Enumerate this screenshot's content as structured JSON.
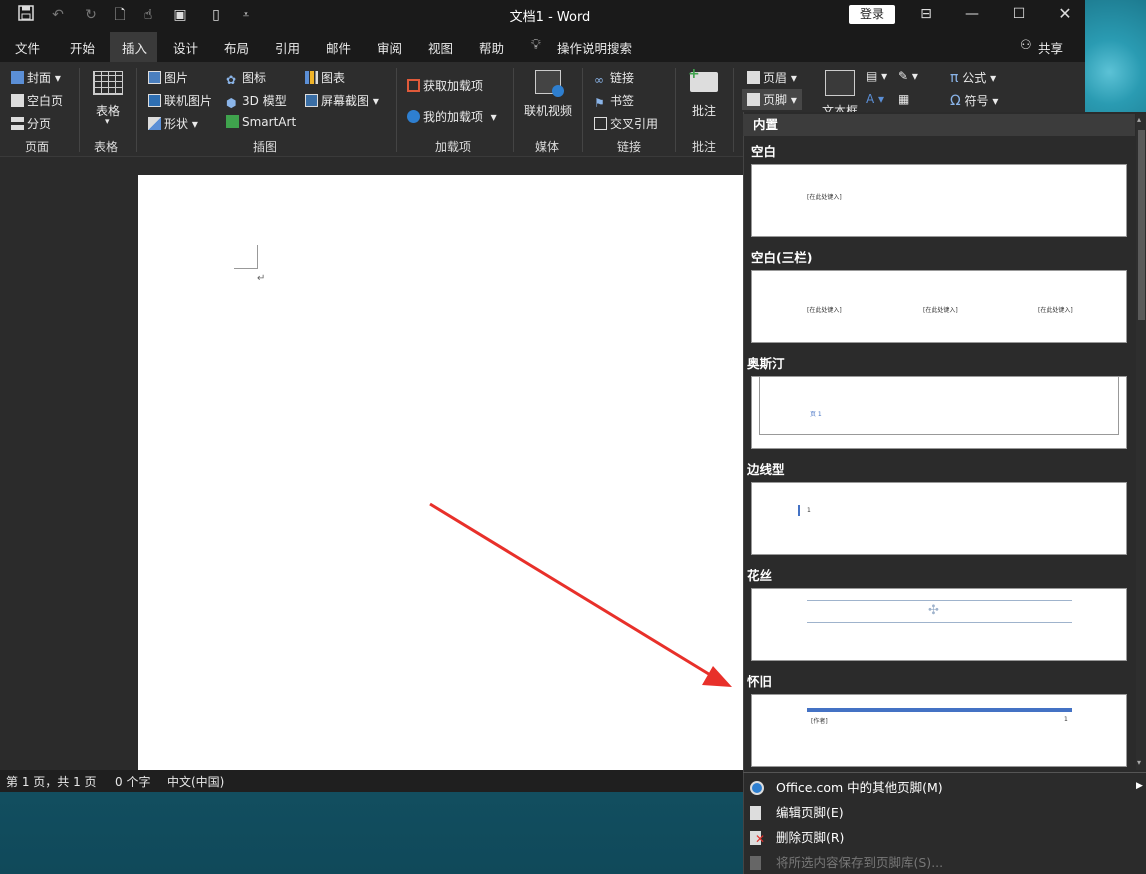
{
  "app": {
    "doc_title": "文档1  -  Word",
    "login": "登录",
    "share": "共享"
  },
  "tabs": [
    "文件",
    "开始",
    "插入",
    "设计",
    "布局",
    "引用",
    "邮件",
    "审阅",
    "视图",
    "帮助"
  ],
  "tell_me": "操作说明搜索",
  "ribbon": {
    "page": {
      "cover": "封面",
      "blank": "空白页",
      "break": "分页",
      "group": "页面"
    },
    "table": {
      "table": "表格",
      "group": "表格"
    },
    "illustrations": {
      "picture": "图片",
      "online_picture": "联机图片",
      "shapes": "形状",
      "icons": "图标",
      "model3d": "3D 模型",
      "smartart": "SmartArt",
      "chart": "图表",
      "screenshot": "屏幕截图",
      "group": "插图"
    },
    "addins": {
      "get": "获取加载项",
      "my": "我的加载项",
      "group": "加载项"
    },
    "media": {
      "video": "联机视频",
      "group": "媒体"
    },
    "links": {
      "link": "链接",
      "bookmark": "书签",
      "crossref": "交叉引用",
      "group": "链接"
    },
    "comments": {
      "comment": "批注",
      "group": "批注"
    },
    "header_footer": {
      "header": "页眉",
      "footer": "页脚"
    },
    "text": {
      "textbox": "文本框"
    },
    "symbols": {
      "equation": "公式",
      "symbol": "符号"
    }
  },
  "status": {
    "page": "第 1 页，共 1 页",
    "words": "0 个字",
    "lang": "中文(中国)"
  },
  "footer_gallery": {
    "header": "内置",
    "items": [
      {
        "label": "空白",
        "preview": [
          "[在此处键入]"
        ]
      },
      {
        "label": "空白(三栏)",
        "preview": [
          "[在此处键入]",
          "[在此处键入]",
          "[在此处键入]"
        ]
      },
      {
        "label": "奥斯汀",
        "preview": [
          "页 1"
        ]
      },
      {
        "label": "边线型",
        "preview": [
          "1"
        ]
      },
      {
        "label": "花丝",
        "preview": []
      },
      {
        "label": "怀旧",
        "preview": [
          "[作者]",
          "1"
        ]
      }
    ],
    "menu": [
      {
        "label": "Office.com 中的其他页脚(M)",
        "enabled": true
      },
      {
        "label": "编辑页脚(E)",
        "enabled": true
      },
      {
        "label": "删除页脚(R)",
        "enabled": true
      },
      {
        "label": "将所选内容保存到页脚库(S)...",
        "enabled": false
      }
    ]
  },
  "colors": {
    "accent_blue": "#4472c4",
    "arrow_red": "#e8302a"
  }
}
